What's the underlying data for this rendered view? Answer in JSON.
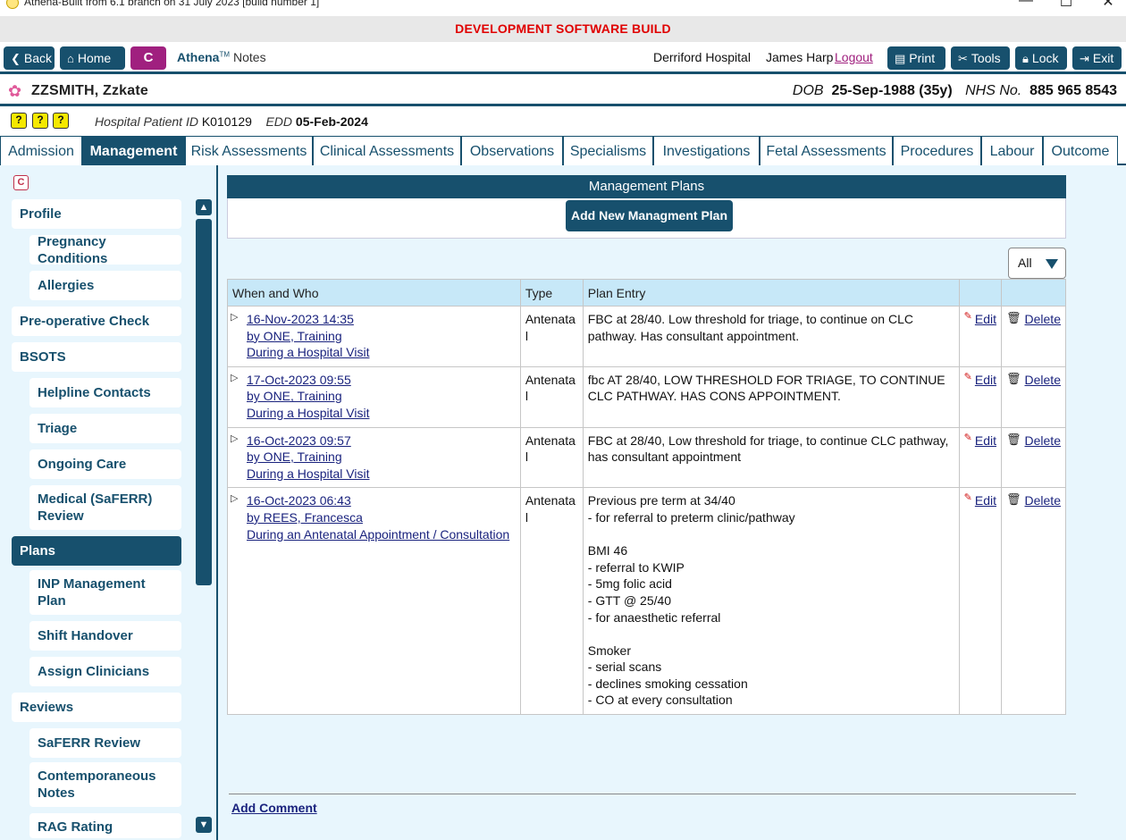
{
  "window": {
    "title": "Athena-Built from 6.1 branch on 31 July 2023 [build number 1]",
    "min": "—",
    "max": "☐",
    "close": "✕"
  },
  "banner": "DEVELOPMENT SOFTWARE BUILD",
  "toolbar": {
    "back": "Back",
    "home": "Home",
    "c": "C",
    "brand": "Athena",
    "tm": "TM",
    "notes": "Notes",
    "hospital": "Derriford Hospital",
    "user": "James Harp",
    "logout": "Logout",
    "print": "Print",
    "tools": "Tools",
    "lock": "Lock",
    "exit": "Exit"
  },
  "patient": {
    "name": "ZZSMITH, Zzkate",
    "dob_label": "DOB",
    "dob": "25-Sep-1988 (35y)",
    "nhs_label": "NHS No.",
    "nhs": "885 965 8543",
    "hospital_id_label": "Hospital Patient ID",
    "hospital_id": "K010129",
    "edd_label": "EDD",
    "edd": "05-Feb-2024",
    "alert_icons": [
      "?",
      "?",
      "?"
    ]
  },
  "tabs": [
    "Admission",
    "Management",
    "Risk Assessments",
    "Clinical Assessments",
    "Observations",
    "Specialisms",
    "Investigations",
    "Fetal Assessments",
    "Procedures",
    "Labour",
    "Outcome"
  ],
  "nav": [
    {
      "label": "Profile"
    },
    {
      "label": "Pregnancy Conditions"
    },
    {
      "label": "Allergies"
    },
    {
      "label": "Pre-operative Check"
    },
    {
      "label": "BSOTS"
    },
    {
      "label": "Helpline Contacts"
    },
    {
      "label": "Triage"
    },
    {
      "label": "Ongoing Care"
    },
    {
      "label": "Medical (SaFERR) Review"
    },
    {
      "label": "Plans"
    },
    {
      "label": "INP Management Plan"
    },
    {
      "label": "Shift Handover"
    },
    {
      "label": "Assign Clinicians"
    },
    {
      "label": "Reviews"
    },
    {
      "label": "SaFERR Review"
    },
    {
      "label": "Contemporaneous Notes"
    },
    {
      "label": "RAG Rating"
    }
  ],
  "plans": {
    "header": "Management Plans",
    "add_button": "Add New Managment Plan",
    "filter": "All",
    "columns": [
      "When and Who",
      "Type",
      "Plan Entry",
      "",
      ""
    ],
    "edit_label": "Edit",
    "delete_label": "Delete",
    "rows": [
      {
        "when": "16-Nov-2023 14:35",
        "who": "by ONE, Training",
        "context": "During a Hospital Visit",
        "type": "Antenata l",
        "entry": "FBC at 28/40. Low threshold for triage, to continue on CLC pathway. Has consultant appointment."
      },
      {
        "when": "17-Oct-2023 09:55",
        "who": "by ONE, Training",
        "context": "During a Hospital Visit",
        "type": "Antenata l",
        "entry": "fbc AT 28/40, LOW THRESHOLD FOR TRIAGE, TO CONTINUE CLC PATHWAY. HAS CONS APPOINTMENT."
      },
      {
        "when": "16-Oct-2023 09:57",
        "who": "by ONE, Training",
        "context": "During a Hospital Visit",
        "type": "Antenata l",
        "entry": "FBC at 28/40, Low threshold for triage, to continue CLC pathway, has consultant appointment"
      },
      {
        "when": "16-Oct-2023 06:43",
        "who": "by REES, Francesca",
        "context": "During an Antenatal Appointment / Consultation",
        "type": "Antenata l",
        "entry": "Previous pre term at 34/40\n- for referral to preterm clinic/pathway\n\nBMI 46\n- referral to KWIP\n- 5mg folic acid\n- GTT @ 25/40\n- for anaesthetic referral\n\nSmoker\n- serial scans\n- declines smoking cessation\n- CO at every consultation"
      }
    ]
  },
  "add_comment": "Add Comment"
}
